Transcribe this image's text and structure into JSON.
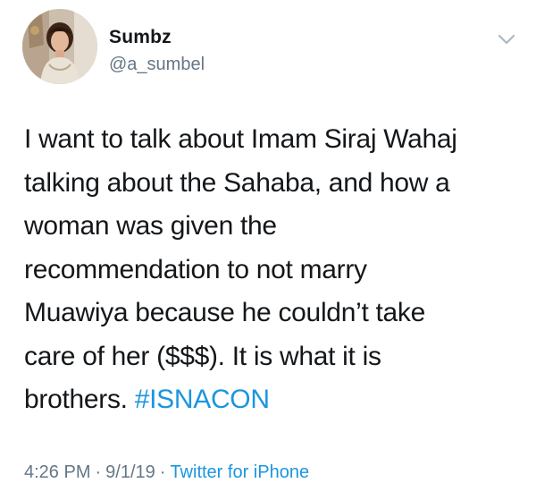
{
  "author": {
    "display_name": "Sumbz",
    "handle": "@a_sumbel",
    "avatar_icon": "profile-photo"
  },
  "tweet": {
    "lines": [
      "I want to talk about Imam Siraj Wahaj",
      "talking about the Sahaba, and how a",
      "woman was given the",
      "recommendation to not marry",
      "Muawiya because he couldn’t take",
      "care of her ($$$). It is what it is"
    ],
    "last_line_prefix": "brothers. ",
    "hashtag": "#ISNACON"
  },
  "meta": {
    "time": "4:26 PM",
    "separator": "·",
    "date": "9/1/19",
    "source": "Twitter for iPhone"
  },
  "colors": {
    "text": "#14171a",
    "secondary": "#657786",
    "link": "#1b95e0",
    "background": "#ffffff"
  },
  "menu_icon": "chevron-down-icon"
}
